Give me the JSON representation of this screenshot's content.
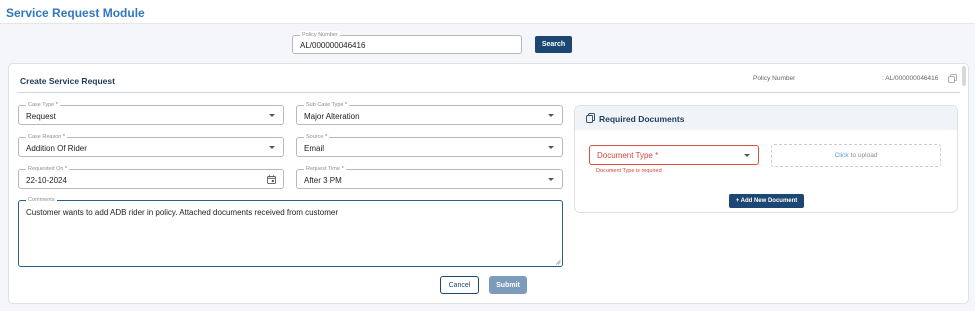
{
  "header": {
    "title": "Service Request Module"
  },
  "search": {
    "policy_label": "Policy Number",
    "policy_value": "AL/000000046416",
    "search_button": "Search"
  },
  "form": {
    "title": "Create Service Request",
    "policy_number_label": "Policy Number",
    "policy_number_value": ": AL/000000046416",
    "case_type": {
      "label": "Case Type",
      "required": "*",
      "value": "Request"
    },
    "sub_case_type": {
      "label": "Sub Case Type",
      "required": "*",
      "value": "Major Alteration"
    },
    "case_reason": {
      "label": "Case Reason",
      "required": "*",
      "value": "Addition Of Rider"
    },
    "source": {
      "label": "Source",
      "required": "*",
      "value": "Email"
    },
    "requested_on": {
      "label": "Requested On",
      "required": "*",
      "value": "22-10-2024"
    },
    "request_time": {
      "label": "Request Time",
      "required": "*",
      "value": "After 3 PM"
    },
    "comments": {
      "label": "Comments",
      "value": "Customer wants to add ADB rider in policy. Attached documents received from customer"
    },
    "cancel_button": "Cancel",
    "submit_button": "Submit"
  },
  "documents": {
    "title": "Required Documents",
    "document_type_placeholder": "Document Type *",
    "document_type_error": "Document Type is required",
    "upload_link": "Click",
    "upload_text": "to upload",
    "add_button": "+ Add New Document"
  },
  "colors": {
    "primary": "#1c4772",
    "title_blue": "#2f77c0",
    "error": "#d0453b",
    "submit_disabled": "#7d9cbb"
  }
}
